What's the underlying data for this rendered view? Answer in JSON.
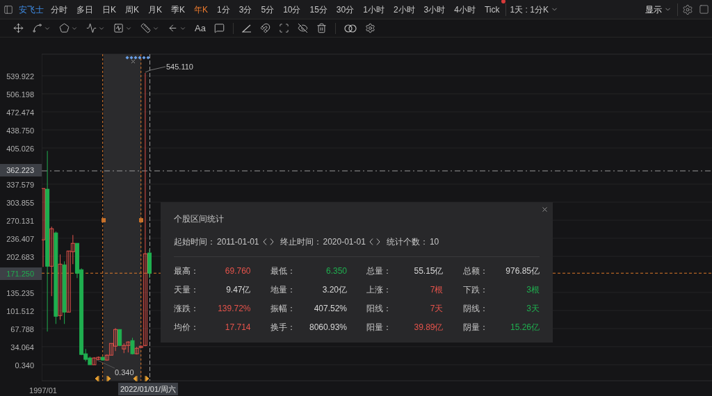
{
  "stock_name": "安飞士",
  "periods": [
    {
      "label": "分时",
      "selected": false,
      "alert": false
    },
    {
      "label": "多日",
      "selected": false,
      "alert": false
    },
    {
      "label": "日K",
      "selected": false,
      "alert": false
    },
    {
      "label": "周K",
      "selected": false,
      "alert": false
    },
    {
      "label": "月K",
      "selected": false,
      "alert": false
    },
    {
      "label": "季K",
      "selected": false,
      "alert": false
    },
    {
      "label": "年K",
      "selected": true,
      "alert": false
    },
    {
      "label": "1分",
      "selected": false,
      "alert": false
    },
    {
      "label": "3分",
      "selected": false,
      "alert": false
    },
    {
      "label": "5分",
      "selected": false,
      "alert": false
    },
    {
      "label": "10分",
      "selected": false,
      "alert": false
    },
    {
      "label": "15分",
      "selected": false,
      "alert": false
    },
    {
      "label": "30分",
      "selected": false,
      "alert": false
    },
    {
      "label": "1小时",
      "selected": false,
      "alert": false
    },
    {
      "label": "2小时",
      "selected": false,
      "alert": false
    },
    {
      "label": "3小时",
      "selected": false,
      "alert": false
    },
    {
      "label": "4小时",
      "selected": false,
      "alert": false
    },
    {
      "label": "Tick",
      "selected": false,
      "alert": true
    }
  ],
  "ratio_select": "1天 : 1分K",
  "display_menu": "显示",
  "text_tool": "Aa",
  "chart": {
    "chart_data": {
      "type": "candlestick",
      "categories": [
        "1997/01",
        null,
        null,
        null,
        null,
        null,
        null,
        null,
        null,
        null,
        null,
        null,
        null,
        null,
        null,
        null,
        null,
        null,
        null,
        null,
        null,
        null,
        null,
        null,
        null,
        "2022/01/01/周六"
      ],
      "grid": true,
      "ref_lines": [
        {
          "axis": "y",
          "value": 362.223,
          "color": "#9a9a9a"
        },
        {
          "axis": "y",
          "value": 171.25,
          "color": "#e07a2a"
        },
        {
          "axis": "x",
          "value": "2022/01/01/周六",
          "color": "#9a9a9a"
        }
      ],
      "ohlc": [
        [
          233.5,
          329.4,
          182.9,
          329.4
        ],
        [
          328.1,
          399.5,
          62.3,
          184.2
        ],
        [
          184.2,
          258.1,
          128.4,
          254.2
        ],
        [
          246.4,
          249.0,
          76.5,
          90.8
        ],
        [
          92.1,
          206.2,
          84.3,
          188.1
        ],
        [
          186.8,
          193.3,
          76.5,
          98.6
        ],
        [
          98.6,
          212.7,
          98.6,
          212.7
        ],
        [
          211.4,
          242.5,
          188.1,
          227.0
        ],
        [
          227.0,
          227.0,
          162.1,
          171.2
        ],
        [
          177.7,
          180.3,
          18.2,
          19.5
        ],
        [
          20.8,
          29.8,
          6.5,
          10.4
        ],
        [
          13.0,
          15.6,
          0.34,
          0.34
        ],
        [
          0.34,
          14.3,
          0.34,
          13.0
        ],
        [
          10.4,
          15.6,
          9.1,
          14.3
        ],
        [
          14.3,
          15.6,
          7.8,
          9.1
        ],
        [
          9.1,
          19.5,
          7.8,
          18.2
        ],
        [
          18.2,
          40.2,
          18.2,
          40.2
        ],
        [
          35.0,
          68.7,
          25.9,
          66.1
        ],
        [
          66.1,
          66.1,
          35.0,
          36.3
        ],
        [
          29.8,
          40.2,
          22.0,
          36.3
        ],
        [
          36.3,
          44.1,
          23.3,
          42.8
        ],
        [
          45.4,
          50.6,
          19.5,
          20.8
        ],
        [
          20.8,
          33.7,
          19.5,
          31.1
        ],
        [
          32.4,
          36.3,
          31.1,
          35.0
        ],
        [
          36.3,
          545.11,
          35.0,
          207.5
        ],
        [
          209.0,
          215.6,
          162.1,
          171.2
        ]
      ],
      "ylim": [
        -29.5,
        580.1
      ],
      "yticks": [
        {
          "value": 539.922,
          "label": "539.922"
        },
        {
          "value": 506.198,
          "label": "506.198"
        },
        {
          "value": 472.474,
          "label": "472.474"
        },
        {
          "value": 438.75,
          "label": "438.750"
        },
        {
          "value": 405.026,
          "label": "405.026"
        },
        {
          "value": 337.579,
          "label": "337.579"
        },
        {
          "value": 303.855,
          "label": "303.855"
        },
        {
          "value": 270.131,
          "label": "270.131"
        },
        {
          "value": 236.407,
          "label": "236.407"
        },
        {
          "value": 202.683,
          "label": "202.683"
        },
        {
          "value": 135.235,
          "label": "135.235"
        },
        {
          "value": 101.512,
          "label": "101.512"
        },
        {
          "value": 67.788,
          "label": "67.788"
        },
        {
          "value": 34.064,
          "label": "34.064"
        },
        {
          "value": 0.34,
          "label": "0.340"
        }
      ]
    },
    "crosshair_labels": [
      {
        "value": "362.223",
        "kind": "plain"
      },
      {
        "value": "171.250",
        "kind": "down"
      }
    ],
    "high_label": "545.110",
    "low_label": "0.340"
  },
  "stats": {
    "title": "个股区间统计",
    "start_label": "起始时间：",
    "start": "2011-01-01",
    "end_label": "终止时间：",
    "end": "2020-01-01",
    "count_label": "统计个数：",
    "count": "10",
    "items": [
      {
        "label": "最高：",
        "value": "69.760",
        "kind": "up"
      },
      {
        "label": "最低：",
        "value": "6.350",
        "kind": "down"
      },
      {
        "label": "总量：",
        "value": "55.15亿",
        "kind": "plain"
      },
      {
        "label": "总额：",
        "value": "976.85亿",
        "kind": "plain"
      },
      {
        "label": "天量：",
        "value": "9.47亿",
        "kind": "plain"
      },
      {
        "label": "地量：",
        "value": "3.20亿",
        "kind": "plain"
      },
      {
        "label": "上涨：",
        "value": "7根",
        "kind": "up"
      },
      {
        "label": "下跌：",
        "value": "3根",
        "kind": "down"
      },
      {
        "label": "涨跌：",
        "value": "139.72%",
        "kind": "up"
      },
      {
        "label": "振幅：",
        "value": "407.52%",
        "kind": "plain"
      },
      {
        "label": "阳线：",
        "value": "7天",
        "kind": "up"
      },
      {
        "label": "阴线：",
        "value": "3天",
        "kind": "down"
      },
      {
        "label": "均价：",
        "value": "17.714",
        "kind": "up"
      },
      {
        "label": "换手：",
        "value": "8060.93%",
        "kind": "plain"
      },
      {
        "label": "阳量：",
        "value": "39.89亿",
        "kind": "up"
      },
      {
        "label": "阴量：",
        "value": "15.26亿",
        "kind": "down"
      }
    ]
  }
}
